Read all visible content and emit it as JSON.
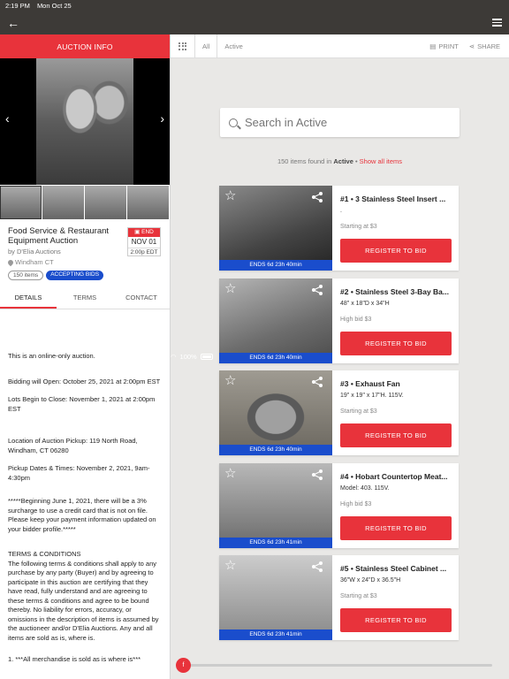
{
  "status": {
    "time": "2:19 PM",
    "date": "Mon Oct 25",
    "battery": "100%"
  },
  "appbar": {
    "back_icon": "arrow-left-icon",
    "menu_icon": "hamburger-icon"
  },
  "left": {
    "tab_label": "AUCTION INFO",
    "auction": {
      "title": "Food Service & Restaurant Equipment Auction",
      "auctioneer": "by D'Elia Auctions",
      "location": "Windham CT",
      "items_badge": "150 items",
      "status_badge": "ACCEPTING BIDS",
      "end_label": "END",
      "end_date": "NOV 01",
      "end_time": "2:00p EDT"
    },
    "tabs": [
      "DETAILS",
      "TERMS",
      "CONTACT"
    ],
    "details": [
      "This is an online-only auction.",
      "Bidding will Open: October 25, 2021 at 2:00pm EST",
      "Lots Begin to Close: November 1, 2021 at 2:00pm EST",
      "Location of Auction Pickup: 119 North Road, Windham, CT 06280",
      "Pickup Dates & Times:  November 2, 2021, 9am-4:30pm",
      "  *****Beginning June 1, 2021, there will be a 3% surcharge to use a credit card that is not on file. Please keep your payment information updated on your bidder profile.*****",
      "TERMS & CONDITIONS\nThe following terms & conditions shall apply to any purchase by any party (Buyer) and by agreeing to participate in this auction are certifying that they have read, fully understand  and are agreeing to these terms & conditions and agree to be bound thereby. No liability for errors, accuracy, or omissions in the description of items is assumed by the auctioneer and/or D'Elia Auctions. Any and all items are sold as is, where is.",
      "1. ***All merchandise is sold as is where is***"
    ]
  },
  "right": {
    "toolbar": {
      "crumb_all": "All",
      "crumb_active": "Active",
      "print": "PRINT",
      "share": "SHARE"
    },
    "search_placeholder": "Search in Active",
    "found": {
      "count_text": "150 items found in",
      "filter": "Active",
      "sep": " • ",
      "show_all": "Show all items"
    },
    "register_label": "REGISTER TO BID",
    "lots": [
      {
        "title": "#1 • 3 Stainless Steel Insert ...",
        "dims": ".",
        "bid": "Starting at $3",
        "ends": "ENDS 6d 23h 40min"
      },
      {
        "title": "#2 • Stainless Steel 3-Bay Ba...",
        "dims": "48\" x 18\"D x 34\"H",
        "bid": "High bid $3",
        "ends": "ENDS 6d 23h 40min"
      },
      {
        "title": "#3 • Exhaust Fan",
        "dims": "19\" x 19\" x 17\"H. 115V.",
        "bid": "Starting at $3",
        "ends": "ENDS 6d 23h 40min"
      },
      {
        "title": "#4 • Hobart Countertop Meat...",
        "dims": "Model: 403. 115V.",
        "bid": "High bid $3",
        "ends": "ENDS 6d 23h 41min"
      },
      {
        "title": "#5 • Stainless Steel Cabinet ...",
        "dims": "36\"W x 24\"D x 36.5\"H",
        "bid": "Starting at $3",
        "ends": "ENDS 6d 23h 41min"
      }
    ],
    "scroll_label": "f"
  },
  "colors": {
    "accent": "#e8333b",
    "blue": "#1a4dcc",
    "topbar": "#3d3a37"
  }
}
